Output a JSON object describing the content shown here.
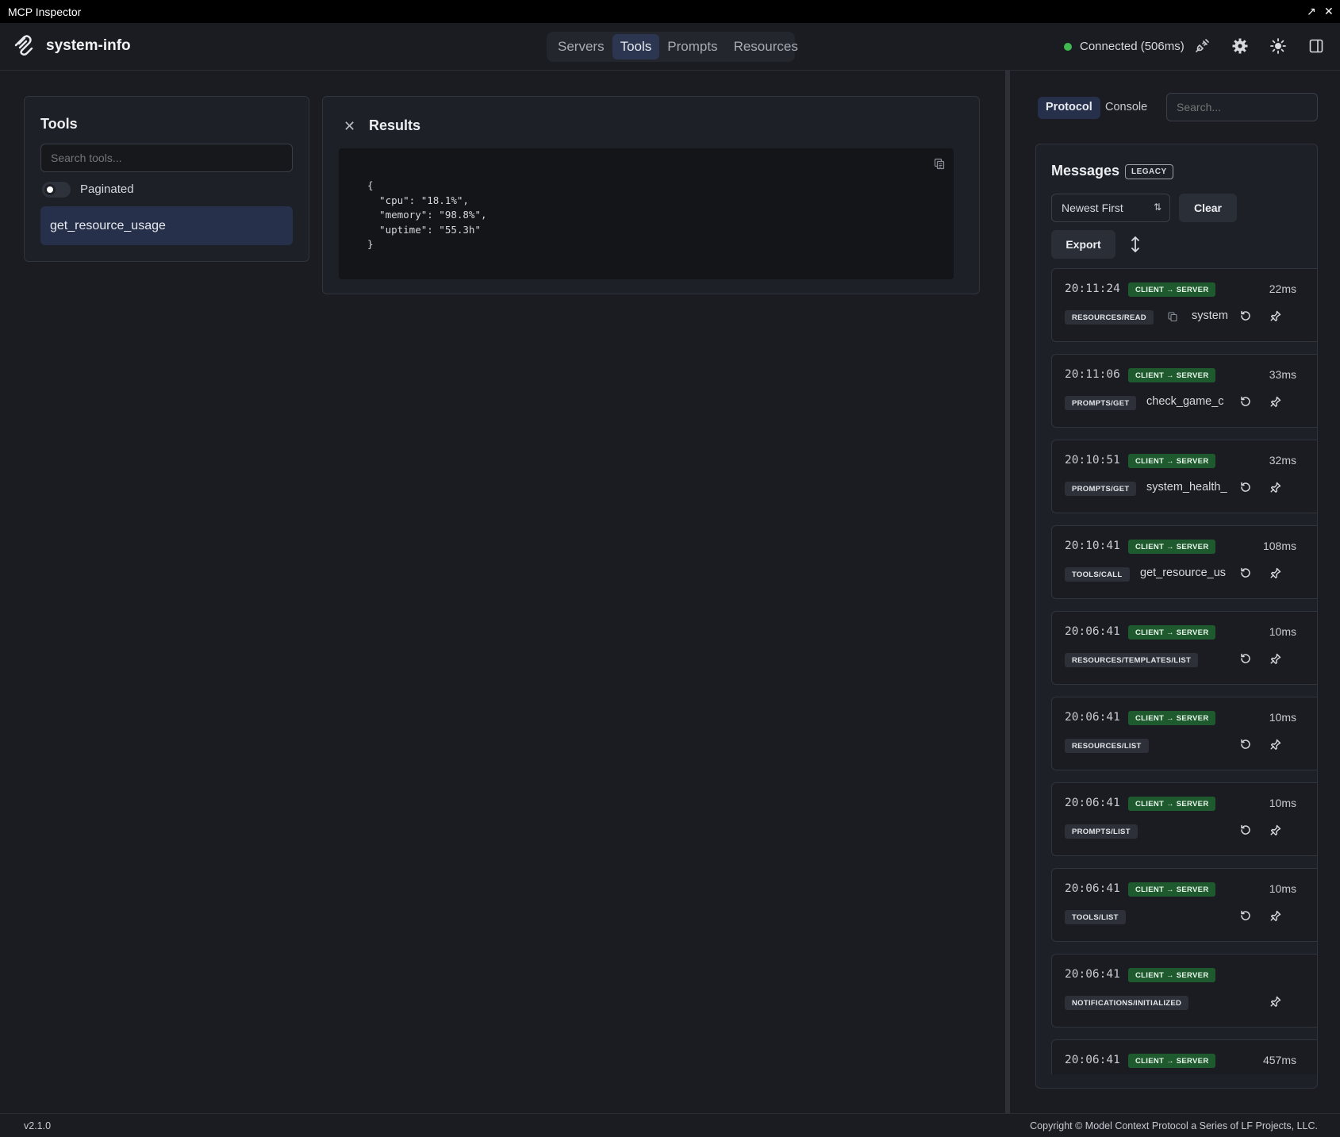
{
  "window": {
    "title": "MCP Inspector",
    "maximize_glyph": "↗",
    "close_glyph": "✕"
  },
  "header": {
    "app_name": "system-info",
    "nav": [
      {
        "label": "Servers",
        "active": false
      },
      {
        "label": "Tools",
        "active": true
      },
      {
        "label": "Prompts",
        "active": false
      },
      {
        "label": "Resources",
        "active": false
      }
    ],
    "connection_status": "Connected (506ms)",
    "icons": [
      "plug-icon",
      "gear-icon",
      "sun-icon",
      "sidebar-toggle-icon"
    ]
  },
  "tools": {
    "title": "Tools",
    "search_placeholder": "Search tools...",
    "paginated_label": "Paginated",
    "items": [
      "get_resource_usage"
    ]
  },
  "results": {
    "title": "Results",
    "close_glyph": "✕",
    "json_text": "{\n  \"cpu\": \"18.1%\",\n  \"memory\": \"98.8%\",\n  \"uptime\": \"55.3h\"\n}"
  },
  "right": {
    "tabs": [
      {
        "label": "Protocol",
        "active": true
      },
      {
        "label": "Console",
        "active": false
      }
    ],
    "search_placeholder": "Search...",
    "messages_title": "Messages",
    "legacy_badge": "LEGACY",
    "sort_value": "Newest First",
    "sort_glyph": "⇅",
    "clear_label": "Clear",
    "export_label": "Export",
    "messages": [
      {
        "time": "20:11:24",
        "direction": "CLIENT → SERVER",
        "duration": "22ms",
        "method": "RESOURCES/READ",
        "name": "system",
        "doc_icon": true,
        "replay": true
      },
      {
        "time": "20:11:06",
        "direction": "CLIENT → SERVER",
        "duration": "33ms",
        "method": "PROMPTS/GET",
        "name": "check_game_c",
        "doc_icon": false,
        "replay": true
      },
      {
        "time": "20:10:51",
        "direction": "CLIENT → SERVER",
        "duration": "32ms",
        "method": "PROMPTS/GET",
        "name": "system_health_",
        "doc_icon": false,
        "replay": true
      },
      {
        "time": "20:10:41",
        "direction": "CLIENT → SERVER",
        "duration": "108ms",
        "method": "TOOLS/CALL",
        "name": "get_resource_us",
        "doc_icon": false,
        "replay": true
      },
      {
        "time": "20:06:41",
        "direction": "CLIENT → SERVER",
        "duration": "10ms",
        "method": "RESOURCES/TEMPLATES/LIST",
        "name": "",
        "doc_icon": false,
        "replay": true
      },
      {
        "time": "20:06:41",
        "direction": "CLIENT → SERVER",
        "duration": "10ms",
        "method": "RESOURCES/LIST",
        "name": "",
        "doc_icon": false,
        "replay": true
      },
      {
        "time": "20:06:41",
        "direction": "CLIENT → SERVER",
        "duration": "10ms",
        "method": "PROMPTS/LIST",
        "name": "",
        "doc_icon": false,
        "replay": true
      },
      {
        "time": "20:06:41",
        "direction": "CLIENT → SERVER",
        "duration": "10ms",
        "method": "TOOLS/LIST",
        "name": "",
        "doc_icon": false,
        "replay": true
      },
      {
        "time": "20:06:41",
        "direction": "CLIENT → SERVER",
        "duration": "",
        "method": "NOTIFICATIONS/INITIALIZED",
        "name": "",
        "doc_icon": false,
        "replay": false
      },
      {
        "time": "20:06:41",
        "direction": "CLIENT → SERVER",
        "duration": "457ms",
        "method": "",
        "name": "",
        "doc_icon": false,
        "replay": false
      }
    ]
  },
  "footer": {
    "version": "v2.1.0",
    "copyright": "Copyright © Model Context Protocol a Series of LF Projects, LLC."
  },
  "colors": {
    "background": "#1a1c21",
    "panel": "#1d2026",
    "active_nav": "#2c3650",
    "connected_dot": "#3fb950",
    "direction_badge": "#1f5a2e"
  }
}
